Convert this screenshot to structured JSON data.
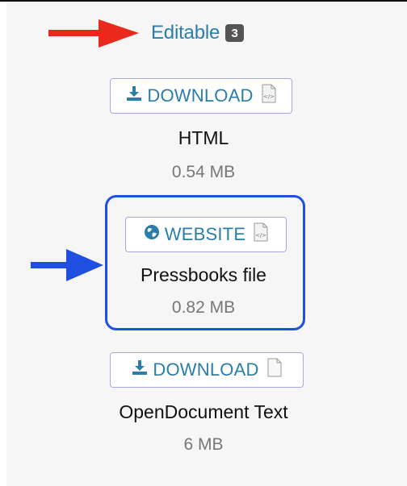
{
  "heading": {
    "label": "Editable",
    "count": "3"
  },
  "formats": [
    {
      "button_label": "DOWNLOAD",
      "button_icon": "download-icon",
      "file_icon": "code-file-icon",
      "name": "HTML",
      "size": "0.54 MB"
    },
    {
      "button_label": "WEBSITE",
      "button_icon": "globe-icon",
      "file_icon": "code-file-icon",
      "name": "Pressbooks file",
      "size": "0.82 MB",
      "highlighted": true
    },
    {
      "button_label": "DOWNLOAD",
      "button_icon": "download-icon",
      "file_icon": "blank-file-icon",
      "name": "OpenDocument Text",
      "size": "6 MB"
    }
  ],
  "annotations": {
    "red_arrow_color": "#e8291c",
    "blue_arrow_color": "#1f4fe0",
    "highlight_color": "#1f4fe0"
  },
  "colors": {
    "link": "#2b7ea8",
    "badge": "#555555",
    "button_border": "#a6a8e0",
    "panel_bg": "#f6f6f6"
  }
}
